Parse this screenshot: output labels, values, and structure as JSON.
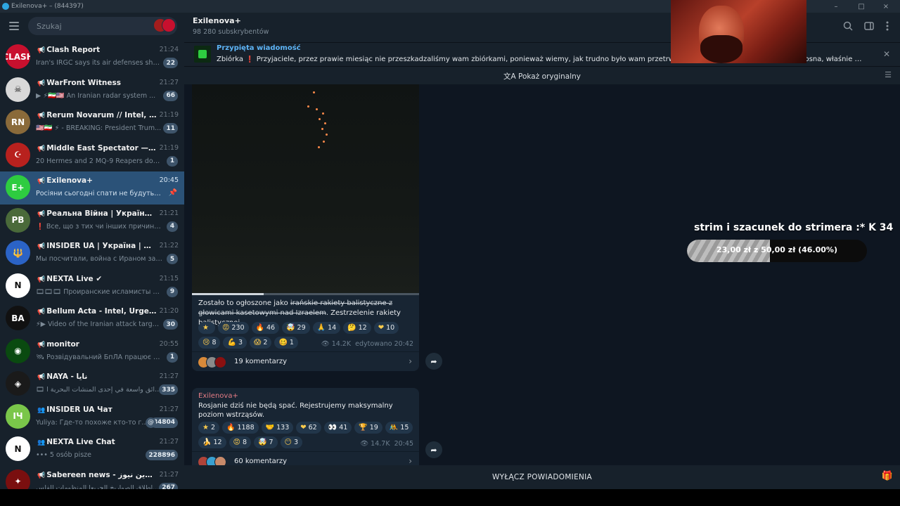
{
  "window": {
    "title": "Exilenova+ – (844397)",
    "controls": [
      "–",
      "□",
      "×"
    ]
  },
  "sidebar": {
    "search_placeholder": "Szukaj",
    "chats": [
      {
        "name": "Clash Report",
        "kind": "channel",
        "time": "21:24",
        "preview": "Iran's IRGC says its air defenses shot d...",
        "badge": "22",
        "avatar_text": "CLASH",
        "avatar_color": "#c8102e"
      },
      {
        "name": "WarFront Witness",
        "kind": "channel",
        "time": "21:27",
        "preview": "▶ ⚡🇮🇷🇺🇸 An Iranian radar system ...",
        "badge": "66",
        "avatar_text": "☠",
        "avatar_color": "#d9d9d9"
      },
      {
        "name": "Rerum Novarum // Intel, Breakin...",
        "kind": "channel",
        "time": "21:19",
        "preview": "🇺🇸🇮🇷 ⚡ - BREAKING: President Trum...",
        "badge": "11",
        "avatar_text": "RN",
        "avatar_color": "#8a6a3a"
      },
      {
        "name": "Middle East Spectator — MES",
        "kind": "channel",
        "time": "21:19",
        "preview": "20 Hermes and 2 MQ-9 Reapers downe...",
        "badge": "1",
        "avatar_text": "☪",
        "avatar_color": "#b8211e"
      },
      {
        "name": "Exilenova+",
        "kind": "channel",
        "time": "20:45",
        "preview": "Росіяни сьогодні спати не будуть. Фік...",
        "badge": "",
        "pinned": true,
        "active": true,
        "avatar_text": "E+",
        "avatar_color": "#2ecc40"
      },
      {
        "name": "Реальна Війна | Україна | Нови...",
        "kind": "channel",
        "time": "21:21",
        "preview": "❗ Все, що з тих чи інших причин не ...",
        "badge": "4",
        "avatar_text": "РВ",
        "avatar_color": "#4a6a3a"
      },
      {
        "name": "INSIDER UA | Україна | Новини",
        "kind": "channel",
        "time": "21:22",
        "preview": "Мы посчитали, война с Ираном займ...",
        "badge": "5",
        "avatar_text": "🔱",
        "avatar_color": "#2b63c6"
      },
      {
        "name": "NEXTA Live ✔",
        "kind": "channel",
        "time": "21:15",
        "preview": "🎞🎞🎞 Проиранские исламисты пы...",
        "badge": "9",
        "avatar_text": "N",
        "avatar_color": "#ffffff"
      },
      {
        "name": "Bellum Acta - Intel, Urgent News ...",
        "kind": "channel",
        "time": "21:20",
        "preview": "⚡▶ Video of the Iranian attack targe...",
        "badge": "30",
        "avatar_text": "BA",
        "avatar_color": "#111111"
      },
      {
        "name": "monitor",
        "kind": "channel",
        "time": "20:55",
        "preview": "🛰 Розвідувальний БпЛА працює поб...",
        "badge": "1",
        "avatar_text": "◉",
        "avatar_color": "#0a4a10"
      },
      {
        "name": "NAYA - نايا",
        "kind": "channel",
        "time": "21:27",
        "preview": "🎞 حرائق واسعة في إحدى المنشآت البحرية ا...",
        "badge": "335",
        "avatar_text": "◈",
        "avatar_color": "#1a1a1a"
      },
      {
        "name": "INSIDER UA Чат",
        "kind": "group",
        "time": "21:27",
        "preview": "Yuliya: Где-то похоже кто-то г...",
        "badge": "84804",
        "mention": true,
        "avatar_text": "IЧ",
        "avatar_color": "#7ac64a"
      },
      {
        "name": "NEXTA Live Chat",
        "kind": "group",
        "time": "21:27",
        "preview": "••• 5 osób pisze",
        "badge": "228896",
        "avatar_text": "N",
        "avatar_color": "#ffffff"
      },
      {
        "name": "Sabereen news - صابرين نيوز",
        "kind": "channel",
        "time": "21:27",
        "preview": "إطلاق الصواريخ الحريعا المنظومات الفلس...",
        "badge": "267",
        "avatar_text": "✦",
        "avatar_color": "#7a0f0f"
      }
    ]
  },
  "channel": {
    "title": "Exilenova+",
    "subscribers": "98 280 subskrybentów"
  },
  "pinned": {
    "label": "Przypięta wiadomość",
    "text": "Zbiórka  ❗  Przyjaciele, przez prawie miesiąc nie przeszkadzaliśmy wam zbiórkami, ponieważ wiemy, jak trudno było wam przetrwać tę zimę. A teraz, kiedy przyszła wiosna, właśnie na waszyc..."
  },
  "translate": {
    "label": "Pokaż oryginalny"
  },
  "messages": [
    {
      "caption_prefix": "Zostało to ogłoszone jako ",
      "caption_strike": "irańskie rakiety balistyczne z głowicami kasetowymi nad Izraelem",
      "caption_suffix": ". Zestrzelenie rakiety balistycznej.",
      "reactions": [
        {
          "emoji": "★",
          "count": ""
        },
        {
          "emoji": "😡",
          "count": "230"
        },
        {
          "emoji": "🔥",
          "count": "46"
        },
        {
          "emoji": "🤯",
          "count": "29"
        },
        {
          "emoji": "🙏",
          "count": "14"
        },
        {
          "emoji": "🤔",
          "count": "12"
        },
        {
          "emoji": "❤",
          "count": "10"
        },
        {
          "emoji": "😢",
          "count": "8"
        },
        {
          "emoji": "💪",
          "count": "3"
        },
        {
          "emoji": "😱",
          "count": "2"
        },
        {
          "emoji": "🥴",
          "count": "1"
        }
      ],
      "views": "14.2K",
      "time": "edytowano 20:42",
      "comments": "19 komentarzy"
    },
    {
      "sender": "Exilenova+",
      "text": "Rosjanie dziś nie będą spać. Rejestrujemy maksymalny poziom wstrząsów.",
      "reactions": [
        {
          "emoji": "★",
          "count": "2"
        },
        {
          "emoji": "🔥",
          "count": "1188"
        },
        {
          "emoji": "🤝",
          "count": "133"
        },
        {
          "emoji": "❤",
          "count": "62"
        },
        {
          "emoji": "👀",
          "count": "41"
        },
        {
          "emoji": "🏆",
          "count": "19"
        },
        {
          "emoji": "🤼",
          "count": "15"
        },
        {
          "emoji": "🍌",
          "count": "12"
        },
        {
          "emoji": "😡",
          "count": "8"
        },
        {
          "emoji": "🤯",
          "count": "7"
        },
        {
          "emoji": "😶",
          "count": "3"
        }
      ],
      "views": "14.7K",
      "time": "20:45",
      "comments": "60 komentarzy"
    }
  ],
  "overlay": {
    "title": "strim i szacunek do strimera :*",
    "count": "34",
    "progress_label": "23,00 zł z 50,00 zł (46.00%)",
    "progress_fraction": 0.46
  },
  "bottom": {
    "mute_label": "WYŁĄCZ POWIADOMIENIA"
  }
}
